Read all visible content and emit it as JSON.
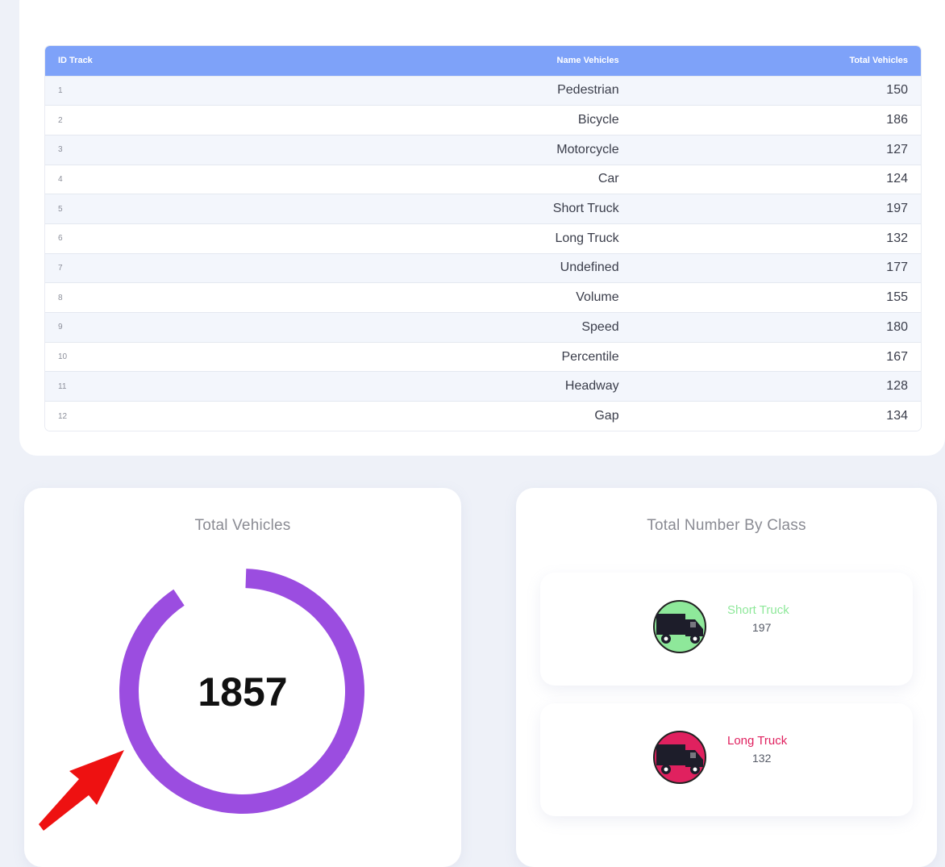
{
  "table": {
    "headers": {
      "id": "ID Track",
      "name": "Name Vehicles",
      "total": "Total Vehicles"
    },
    "rows": [
      {
        "id": "1",
        "name": "Pedestrian",
        "total": "150"
      },
      {
        "id": "2",
        "name": "Bicycle",
        "total": "186"
      },
      {
        "id": "3",
        "name": "Motorcycle",
        "total": "127"
      },
      {
        "id": "4",
        "name": "Car",
        "total": "124"
      },
      {
        "id": "5",
        "name": "Short Truck",
        "total": "197"
      },
      {
        "id": "6",
        "name": "Long Truck",
        "total": "132"
      },
      {
        "id": "7",
        "name": "Undefined",
        "total": "177"
      },
      {
        "id": "8",
        "name": "Volume",
        "total": "155"
      },
      {
        "id": "9",
        "name": "Speed",
        "total": "180"
      },
      {
        "id": "10",
        "name": "Percentile",
        "total": "167"
      },
      {
        "id": "11",
        "name": "Headway",
        "total": "128"
      },
      {
        "id": "12",
        "name": "Gap",
        "total": "134"
      }
    ]
  },
  "total_vehicles": {
    "title": "Total Vehicles",
    "value": "1857",
    "ring_fill_fraction": 0.9,
    "ring_color": "#9b4de0"
  },
  "by_class": {
    "title": "Total Number By Class",
    "items": [
      {
        "label": "Short Truck",
        "count": "197",
        "color": "#8ee89a",
        "icon": "truck-icon"
      },
      {
        "label": "Long Truck",
        "count": "132",
        "color": "#e0215f",
        "icon": "truck-icon"
      }
    ]
  },
  "colors": {
    "table_header": "#7ea2f9",
    "arrow": "#ee1111"
  }
}
